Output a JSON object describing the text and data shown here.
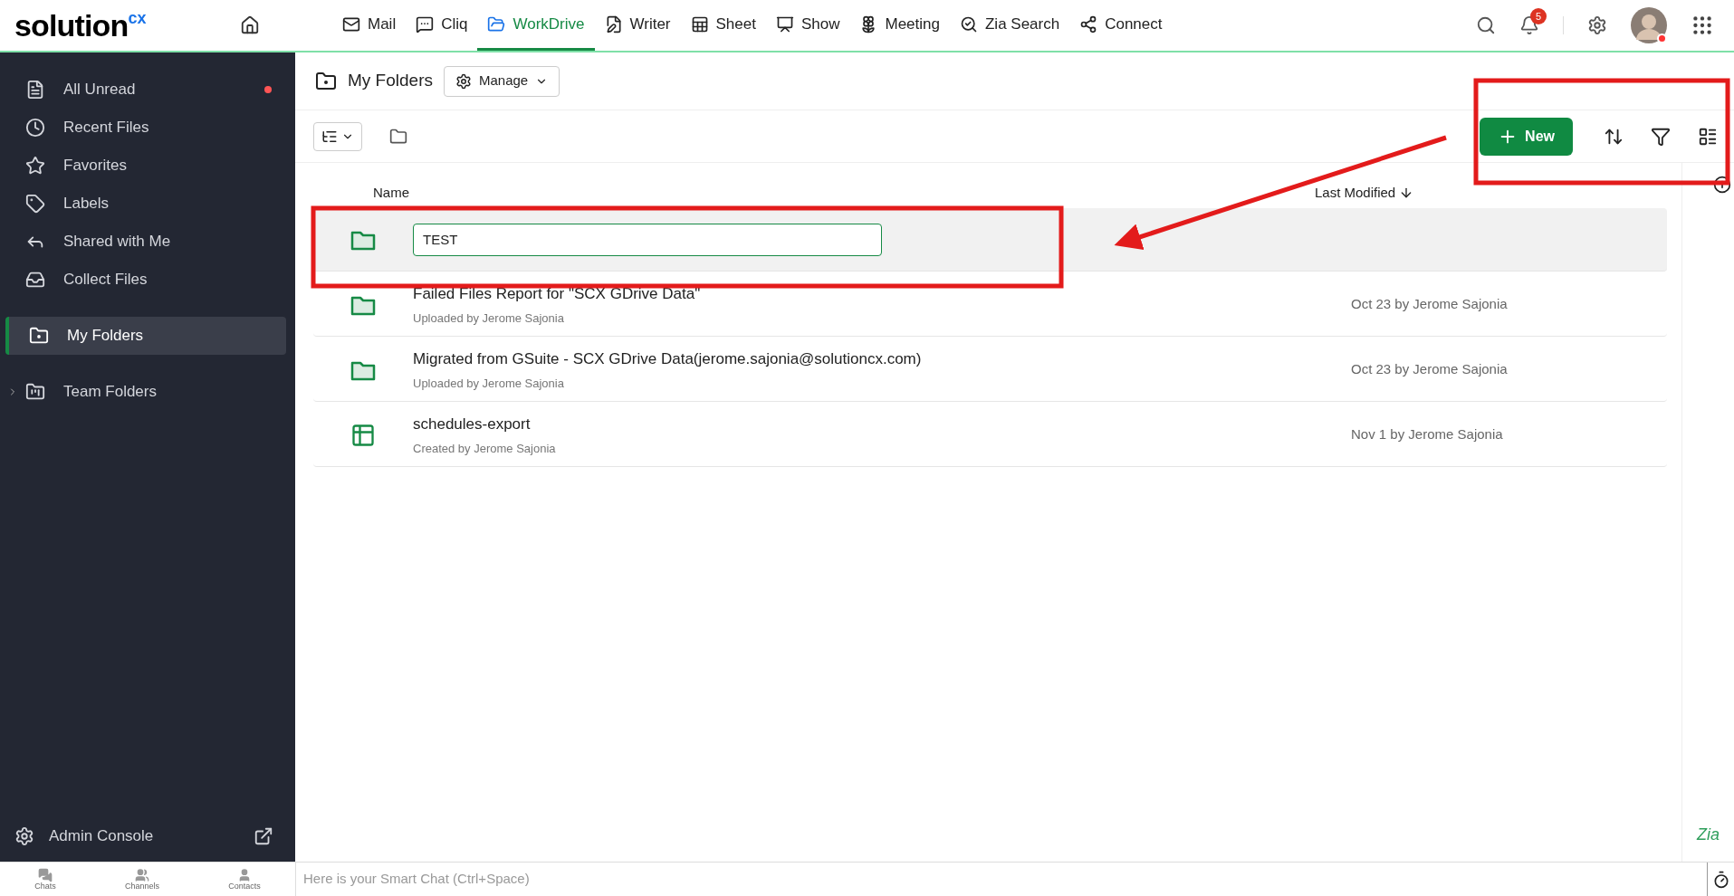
{
  "logo": {
    "text": "solution",
    "sup": "cx"
  },
  "nav": [
    {
      "label": "Mail",
      "selected": false
    },
    {
      "label": "Cliq",
      "selected": false
    },
    {
      "label": "WorkDrive",
      "selected": true
    },
    {
      "label": "Writer",
      "selected": false
    },
    {
      "label": "Sheet",
      "selected": false
    },
    {
      "label": "Show",
      "selected": false
    },
    {
      "label": "Meeting",
      "selected": false
    },
    {
      "label": "Zia Search",
      "selected": false
    },
    {
      "label": "Connect",
      "selected": false
    }
  ],
  "notifications": {
    "count": "5"
  },
  "sidebar": {
    "items": [
      {
        "label": "All Unread",
        "selected": false,
        "unread_dot": true
      },
      {
        "label": "Recent Files",
        "selected": false,
        "unread_dot": false
      },
      {
        "label": "Favorites",
        "selected": false,
        "unread_dot": false
      },
      {
        "label": "Labels",
        "selected": false,
        "unread_dot": false
      },
      {
        "label": "Shared with Me",
        "selected": false,
        "unread_dot": false
      },
      {
        "label": "Collect Files",
        "selected": false,
        "unread_dot": false
      },
      {
        "label": "My Folders",
        "selected": true,
        "unread_dot": false
      },
      {
        "label": "Team Folders",
        "selected": false,
        "unread_dot": false,
        "expanded": false
      }
    ],
    "footer": "Admin Console"
  },
  "header": {
    "title": "My Folders",
    "manage": "Manage"
  },
  "toolbar": {
    "new": "New"
  },
  "table": {
    "columns": [
      "Name",
      "Last Modified"
    ],
    "rows": [
      {
        "kind": "rename",
        "value": "TEST",
        "selected": true
      },
      {
        "kind": "folder",
        "name": "Failed Files Report for \"SCX GDrive Data\"",
        "sub": "Uploaded by Jerome Sajonia",
        "modified": "Oct 23 by Jerome Sajonia",
        "selected": false
      },
      {
        "kind": "folder",
        "name": "Migrated from GSuite - SCX GDrive Data(jerome.sajonia@solutioncx.com)",
        "sub": "Uploaded by Jerome Sajonia",
        "modified": "Oct 23 by Jerome Sajonia",
        "selected": false
      },
      {
        "kind": "spreadsheet",
        "name": "schedules-export",
        "sub": "Created by Jerome Sajonia",
        "modified": "Nov 1 by Jerome Sajonia",
        "selected": false
      }
    ]
  },
  "assistant": "Zia",
  "chatbar": {
    "tabs": [
      "Chats",
      "Channels",
      "Contacts"
    ],
    "placeholder": "Here is your Smart Chat (Ctrl+Space)"
  }
}
